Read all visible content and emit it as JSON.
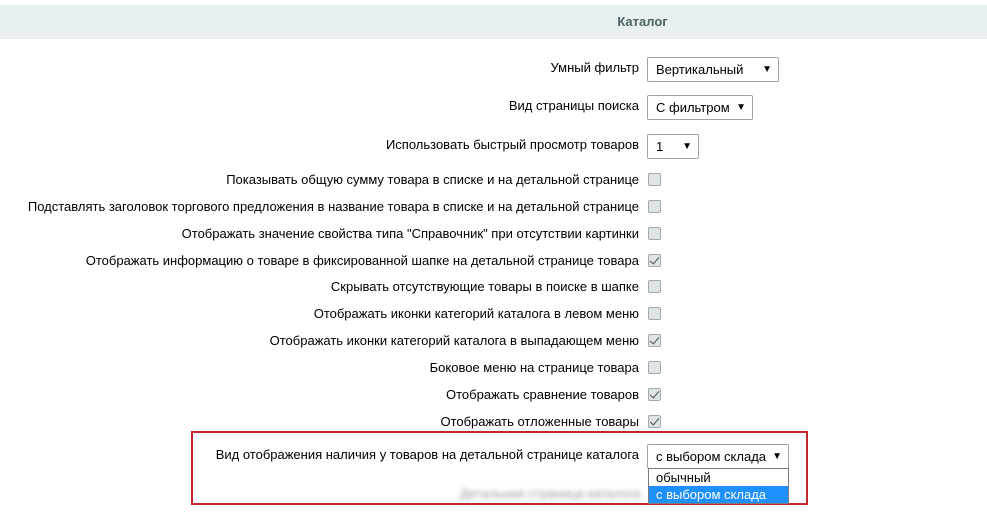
{
  "header": {
    "title": "Каталог"
  },
  "settings": {
    "smart_filter": {
      "label": "Умный фильтр",
      "value": "Вертикальный"
    },
    "search_page_view": {
      "label": "Вид страницы поиска",
      "value": "С фильтром"
    },
    "quick_view": {
      "label": "Использовать быстрый просмотр товаров",
      "value": "1"
    },
    "checkboxes": [
      {
        "label": "Показывать общую сумму товара в списке и на детальной странице",
        "checked": false
      },
      {
        "label": "Подставлять заголовок торгового предложения в название товара в списке и на детальной странице",
        "checked": false
      },
      {
        "label": "Отображать значение свойства типа \"Справочник\" при отсутствии картинки",
        "checked": false
      },
      {
        "label": "Отображать информацию о товаре в фиксированной шапке на детальной странице товара",
        "checked": true
      },
      {
        "label": "Скрывать отсутствующие товары в поиске в шапке",
        "checked": false
      },
      {
        "label": "Отображать иконки категорий каталога в левом меню",
        "checked": false
      },
      {
        "label": "Отображать иконки категорий каталога в выпадающем меню",
        "checked": true
      },
      {
        "label": "Боковое меню на странице товара",
        "checked": false
      },
      {
        "label": "Отображать сравнение товаров",
        "checked": true
      },
      {
        "label": "Отображать отложенные товары",
        "checked": true
      }
    ],
    "availability_view": {
      "label": "Вид отображения наличия у товаров на детальной странице каталога",
      "value": "с выбором склада",
      "options": [
        "обычный",
        "с выбором склада"
      ],
      "selected_option": "с выбором склада"
    },
    "detail_page_blurred": {
      "label": "Детальная страница каталога"
    }
  },
  "colors": {
    "header_bg": "#e8eff1",
    "highlight_border": "#c0262c",
    "option_selected": "#1e90ff"
  }
}
